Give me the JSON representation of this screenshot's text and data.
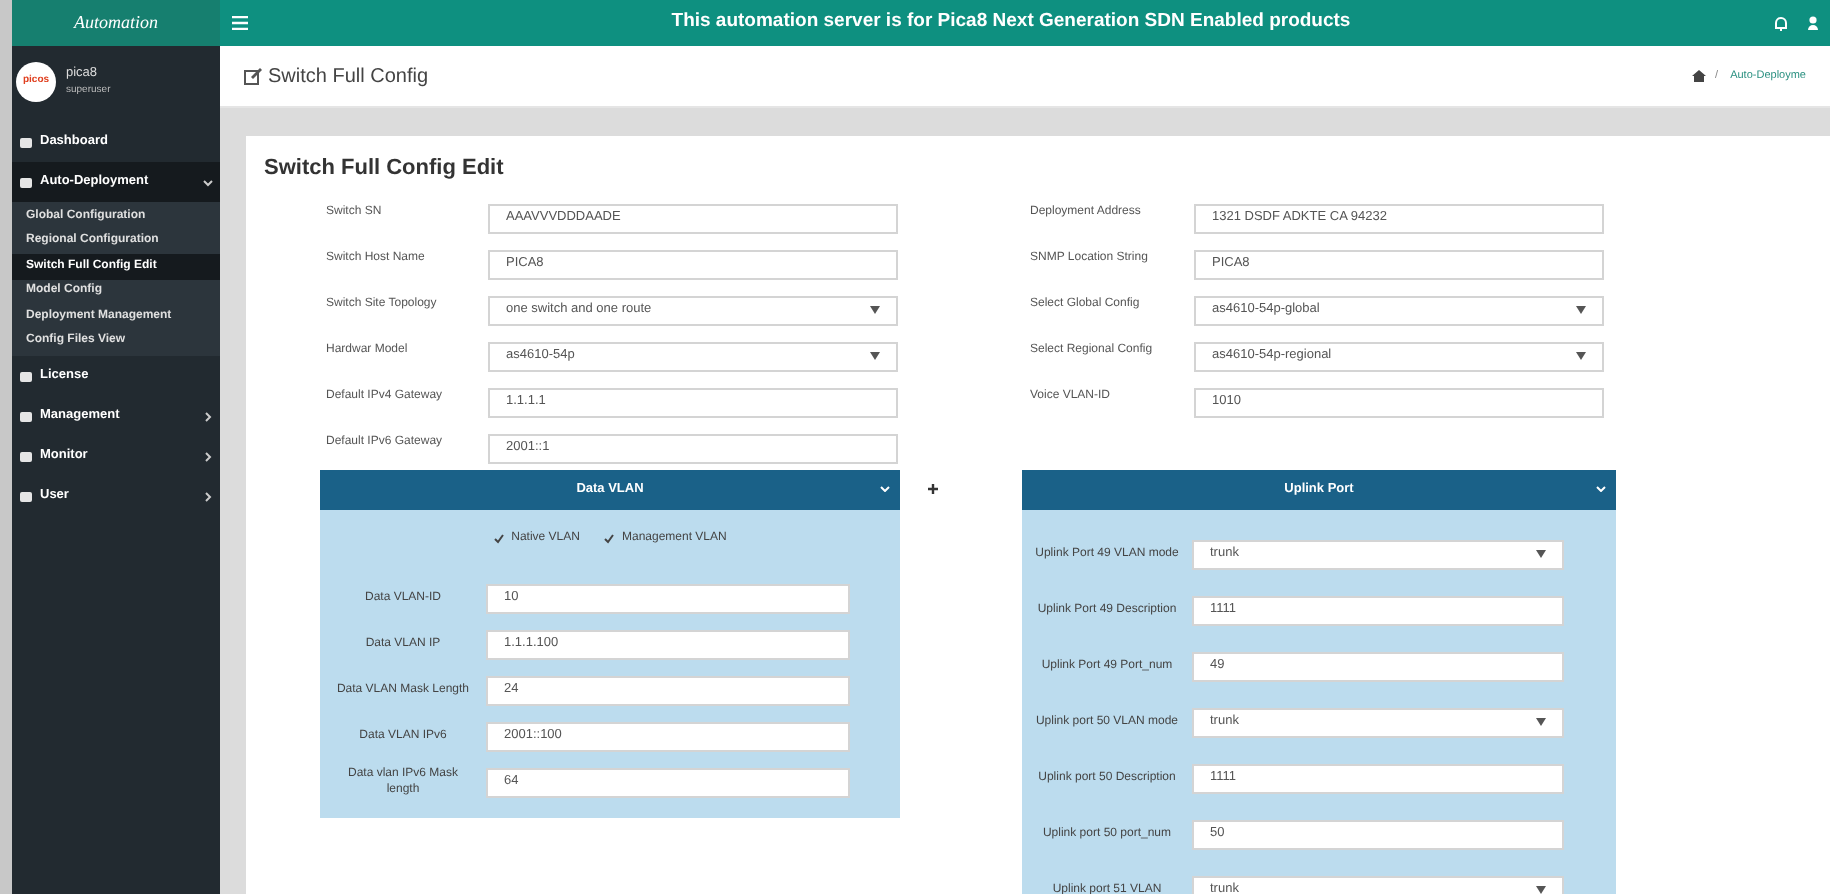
{
  "top_bar": {
    "brand": "Automation",
    "banner": "This automation server is for Pica8 Next Generation SDN Enabled products"
  },
  "user": {
    "logo": "picos",
    "name": "pica8",
    "role": "superuser"
  },
  "sidebar": {
    "items": [
      {
        "label": "Dashboard",
        "kind": "plain",
        "selected": false
      },
      {
        "label": "Auto-Deployment",
        "kind": "dropdown",
        "expanded": true,
        "selected": true,
        "children": [
          {
            "label": "Global Configuration",
            "selected": false
          },
          {
            "label": "Regional Configuration",
            "selected": false
          },
          {
            "label": "Switch Full Config Edit",
            "selected": true
          },
          {
            "label": "Model Config",
            "selected": false
          },
          {
            "label": "Deployment Management",
            "selected": false
          },
          {
            "label": "Config Files View",
            "selected": false
          }
        ]
      },
      {
        "label": "License",
        "kind": "plain",
        "selected": false
      },
      {
        "label": "Management",
        "kind": "submenu",
        "expanded": false,
        "selected": false
      },
      {
        "label": "Monitor",
        "kind": "submenu",
        "expanded": false,
        "selected": false
      },
      {
        "label": "User",
        "kind": "submenu",
        "expanded": false,
        "selected": false
      }
    ]
  },
  "page_title": "Switch Full Config",
  "breadcrumb_separator": "/",
  "breadcrumb": "Auto-Deployme",
  "form": {
    "title": "Switch Full Config Edit",
    "left_fields": [
      {
        "label": "Switch SN",
        "value": "AAAVVVDDDAADE",
        "kind": "input"
      },
      {
        "label": "Switch Host Name",
        "value": "PICA8",
        "kind": "input"
      },
      {
        "label": "Switch Site Topology",
        "value": "one switch and one route",
        "kind": "select"
      },
      {
        "label": "Hardwar Model",
        "value": "as4610-54p",
        "kind": "select"
      },
      {
        "label": "Default IPv4 Gateway",
        "value": "1.1.1.1",
        "kind": "input"
      },
      {
        "label": "Default IPv6 Gateway",
        "value": "2001::1",
        "kind": "input"
      }
    ],
    "right_fields": [
      {
        "label": "Deployment Address",
        "value": "1321 DSDF ADKTE CA 94232",
        "kind": "input"
      },
      {
        "label": "SNMP Location String",
        "value": "PICA8",
        "kind": "input"
      },
      {
        "label": "Select Global Config",
        "value": "as4610-54p-global",
        "kind": "select"
      },
      {
        "label": "Select Regional Config",
        "value": "as4610-54p-regional",
        "kind": "select"
      },
      {
        "label": "Voice VLAN-ID",
        "value": "1010",
        "kind": "input"
      }
    ]
  },
  "data_vlan": {
    "title": "Data VLAN",
    "checkboxes": [
      {
        "label": "Native VLAN",
        "checked": true
      },
      {
        "label": "Management VLAN",
        "checked": true
      }
    ],
    "fields": [
      {
        "label": "Data VLAN-ID",
        "value": "10",
        "kind": "input"
      },
      {
        "label": "Data VLAN IP",
        "value": "1.1.1.100",
        "kind": "input"
      },
      {
        "label": "Data VLAN Mask Length",
        "value": "24",
        "kind": "input"
      },
      {
        "label": "Data VLAN IPv6",
        "value": "2001::100",
        "kind": "input"
      },
      {
        "label": "Data vlan IPv6 Mask length",
        "value": "64",
        "kind": "input"
      }
    ]
  },
  "uplink_port": {
    "title": "Uplink Port",
    "fields": [
      {
        "label": "Uplink Port 49 VLAN mode",
        "value": "trunk",
        "kind": "select"
      },
      {
        "label": "Uplink Port 49 Description",
        "value": "1111",
        "kind": "input"
      },
      {
        "label": "Uplink Port 49 Port_num",
        "value": "49",
        "kind": "input"
      },
      {
        "label": "Uplink port 50 VLAN mode",
        "value": "trunk",
        "kind": "select"
      },
      {
        "label": "Uplink port 50 Description",
        "value": "1111",
        "kind": "input"
      },
      {
        "label": "Uplink port 50 port_num",
        "value": "50",
        "kind": "input"
      },
      {
        "label": "Uplink port 51 VLAN",
        "value": "trunk",
        "kind": "select"
      }
    ]
  }
}
